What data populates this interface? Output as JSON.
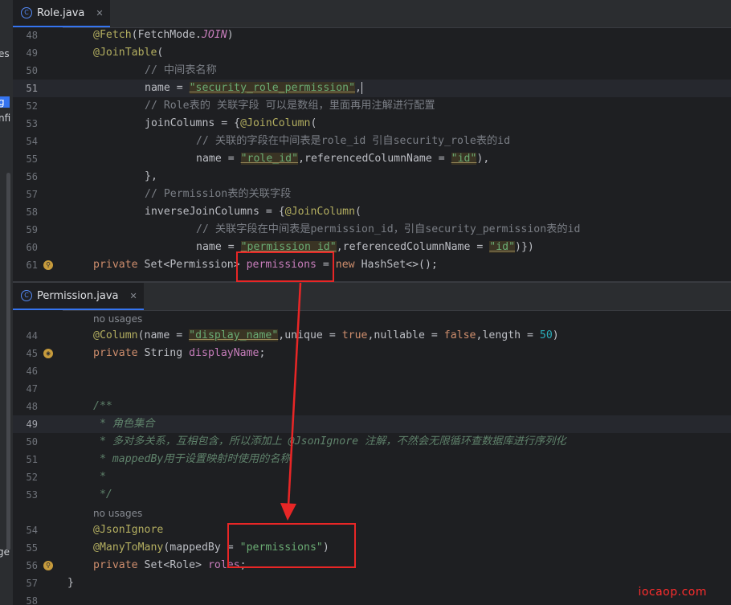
{
  "sidebar": {
    "fragments": [
      "es",
      "g",
      "nfi",
      "ge"
    ]
  },
  "editor_top": {
    "tab": {
      "label": "Role.java",
      "icon": "class-icon",
      "close": "✕"
    },
    "lines": [
      {
        "n": "48",
        "text": "@Fetch(FetchMode.JOIN)"
      },
      {
        "n": "49",
        "text": "@JoinTable("
      },
      {
        "n": "50",
        "text": "// 中间表名称"
      },
      {
        "n": "51",
        "text": "name = \"security_role_permission\","
      },
      {
        "n": "52",
        "text": "// Role表的 关联字段 可以是数组，里面再用注解进行配置"
      },
      {
        "n": "53",
        "text": "joinColumns = {@JoinColumn("
      },
      {
        "n": "54",
        "text": "// 关联的字段在中间表是role_id 引自security_role表的id"
      },
      {
        "n": "55",
        "text": "name = \"role_id\",referencedColumnName = \"id\"),"
      },
      {
        "n": "56",
        "text": "},"
      },
      {
        "n": "57",
        "text": "// Permission表的关联字段"
      },
      {
        "n": "58",
        "text": "inverseJoinColumns = {@JoinColumn("
      },
      {
        "n": "59",
        "text": "// 关联字段在中间表是permission_id，引自security_permission表的id"
      },
      {
        "n": "60",
        "text": "name = \"permission_id\",referencedColumnName = \"id\")})"
      },
      {
        "n": "61",
        "text": "private Set<Permission> permissions = new HashSet<>();"
      }
    ]
  },
  "editor_bottom": {
    "tab": {
      "label": "Permission.java",
      "icon": "class-icon",
      "close": "✕"
    },
    "hints": [
      "no usages",
      "no usages"
    ],
    "lines": [
      {
        "n": "44",
        "text": "@Column(name = \"display_name\",unique = true,nullable = false,length = 50)"
      },
      {
        "n": "45",
        "text": "private String displayName;"
      },
      {
        "n": "46",
        "text": ""
      },
      {
        "n": "47",
        "text": ""
      },
      {
        "n": "48",
        "text": "/**"
      },
      {
        "n": "49",
        "text": " * 角色集合"
      },
      {
        "n": "50",
        "text": " * 多对多关系，互相包含，所以添加上 @JsonIgnore 注解，不然会无限循环查数据库进行序列化"
      },
      {
        "n": "51",
        "text": " * mappedBy用于设置映射时使用的名称"
      },
      {
        "n": "52",
        "text": " *"
      },
      {
        "n": "53",
        "text": " */"
      },
      {
        "n": "54",
        "text": "@JsonIgnore"
      },
      {
        "n": "55",
        "text": "@ManyToMany(mappedBy = \"permissions\")"
      },
      {
        "n": "56",
        "text": "private Set<Role> roles;"
      },
      {
        "n": "57",
        "text": "}"
      },
      {
        "n": "58",
        "text": ""
      }
    ]
  },
  "watermark": "iocaop.com",
  "colors": {
    "background": "#1e1f22",
    "keyword": "#cf8e6d",
    "annotation": "#b3ae60",
    "string": "#6aab73",
    "field": "#c77dbb",
    "comment": "#7a7e85",
    "annotation_box": "#e82626"
  }
}
